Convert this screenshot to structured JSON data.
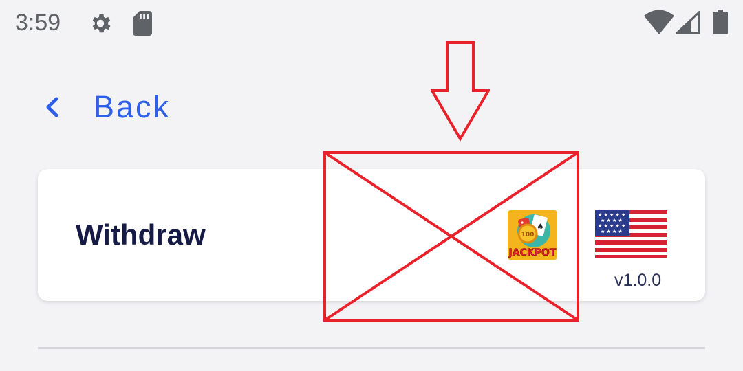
{
  "status_bar": {
    "time": "3:59",
    "icons": [
      "gear-icon",
      "sd-card-icon",
      "wifi-icon",
      "cell-signal-icon",
      "battery-icon"
    ]
  },
  "nav": {
    "back_label": "Back",
    "back_icon": "chevron-left-icon"
  },
  "card": {
    "title": "Withdraw",
    "app_icon": "jackpot-app-icon",
    "app_icon_text": "JACKPOT",
    "app_icon_chip_value": "100",
    "flag": "us-flag-icon",
    "version": "v1.0.0"
  },
  "colors": {
    "accent": "#2f5fe8",
    "title": "#151b45",
    "annotation": "#e8212b",
    "background": "#f3f3f6"
  }
}
